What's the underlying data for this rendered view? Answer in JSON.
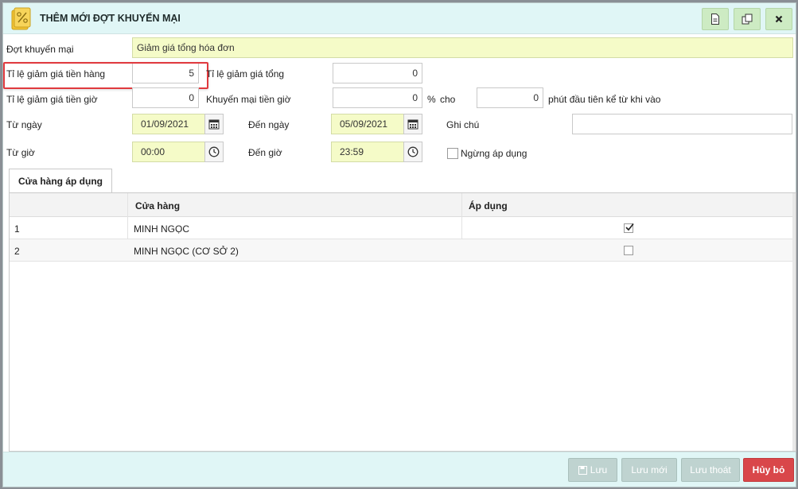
{
  "dialog": {
    "title": "THÊM MỚI ĐỢT KHUYẾN MẠI",
    "icons": [
      "promotion-app-icon",
      "document-icon",
      "copy-icon",
      "close-icon"
    ]
  },
  "form": {
    "campaign_label": "Đợt khuyến mại",
    "campaign_value": "Giảm giá tổng hóa đơn",
    "goods_discount_label": "Tỉ lệ giảm giá tiền hàng",
    "goods_discount_value": "5",
    "total_discount_label": "Tỉ lệ giảm giá tổng",
    "total_discount_value": "0",
    "hour_discount_label": "Tỉ lệ giảm giá tiền giờ",
    "hour_discount_value": "0",
    "hour_promo_label": "Khuyến mại tiền giờ",
    "hour_promo_value": "0",
    "percent_sign": "%",
    "for_label": "cho",
    "minutes_value": "0",
    "minutes_label": "phút đầu tiên kể từ khi vào",
    "from_date_label": "Từ ngày",
    "from_date_value": "01/09/2021",
    "to_date_label": "Đến ngày",
    "to_date_value": "05/09/2021",
    "note_label": "Ghi chú",
    "note_value": "",
    "from_time_label": "Từ giờ",
    "from_time_value": "00:00",
    "to_time_label": "Đến giờ",
    "to_time_value": "23:59",
    "stop_apply_label": "Ngừng áp dụng"
  },
  "tabs": [
    {
      "label": "Cửa hàng áp dụng"
    }
  ],
  "table": {
    "columns": [
      "",
      "Cửa hàng",
      "Áp dụng"
    ],
    "rows": [
      {
        "index": "1",
        "store": "MINH NGỌC",
        "applied": true
      },
      {
        "index": "2",
        "store": "MINH NGỌC (CƠ SỞ 2)",
        "applied": false
      }
    ]
  },
  "footer": {
    "save_label": "Lưu",
    "save_new_label": "Lưu mới",
    "save_exit_label": "Lưu thoát",
    "cancel_label": "Hủy bỏ"
  },
  "colors": {
    "header_bg": "#e0f6f6",
    "input_yellow": "#f5fbc8",
    "cancel_red": "#d9474a",
    "highlight_red": "#e0393e"
  }
}
